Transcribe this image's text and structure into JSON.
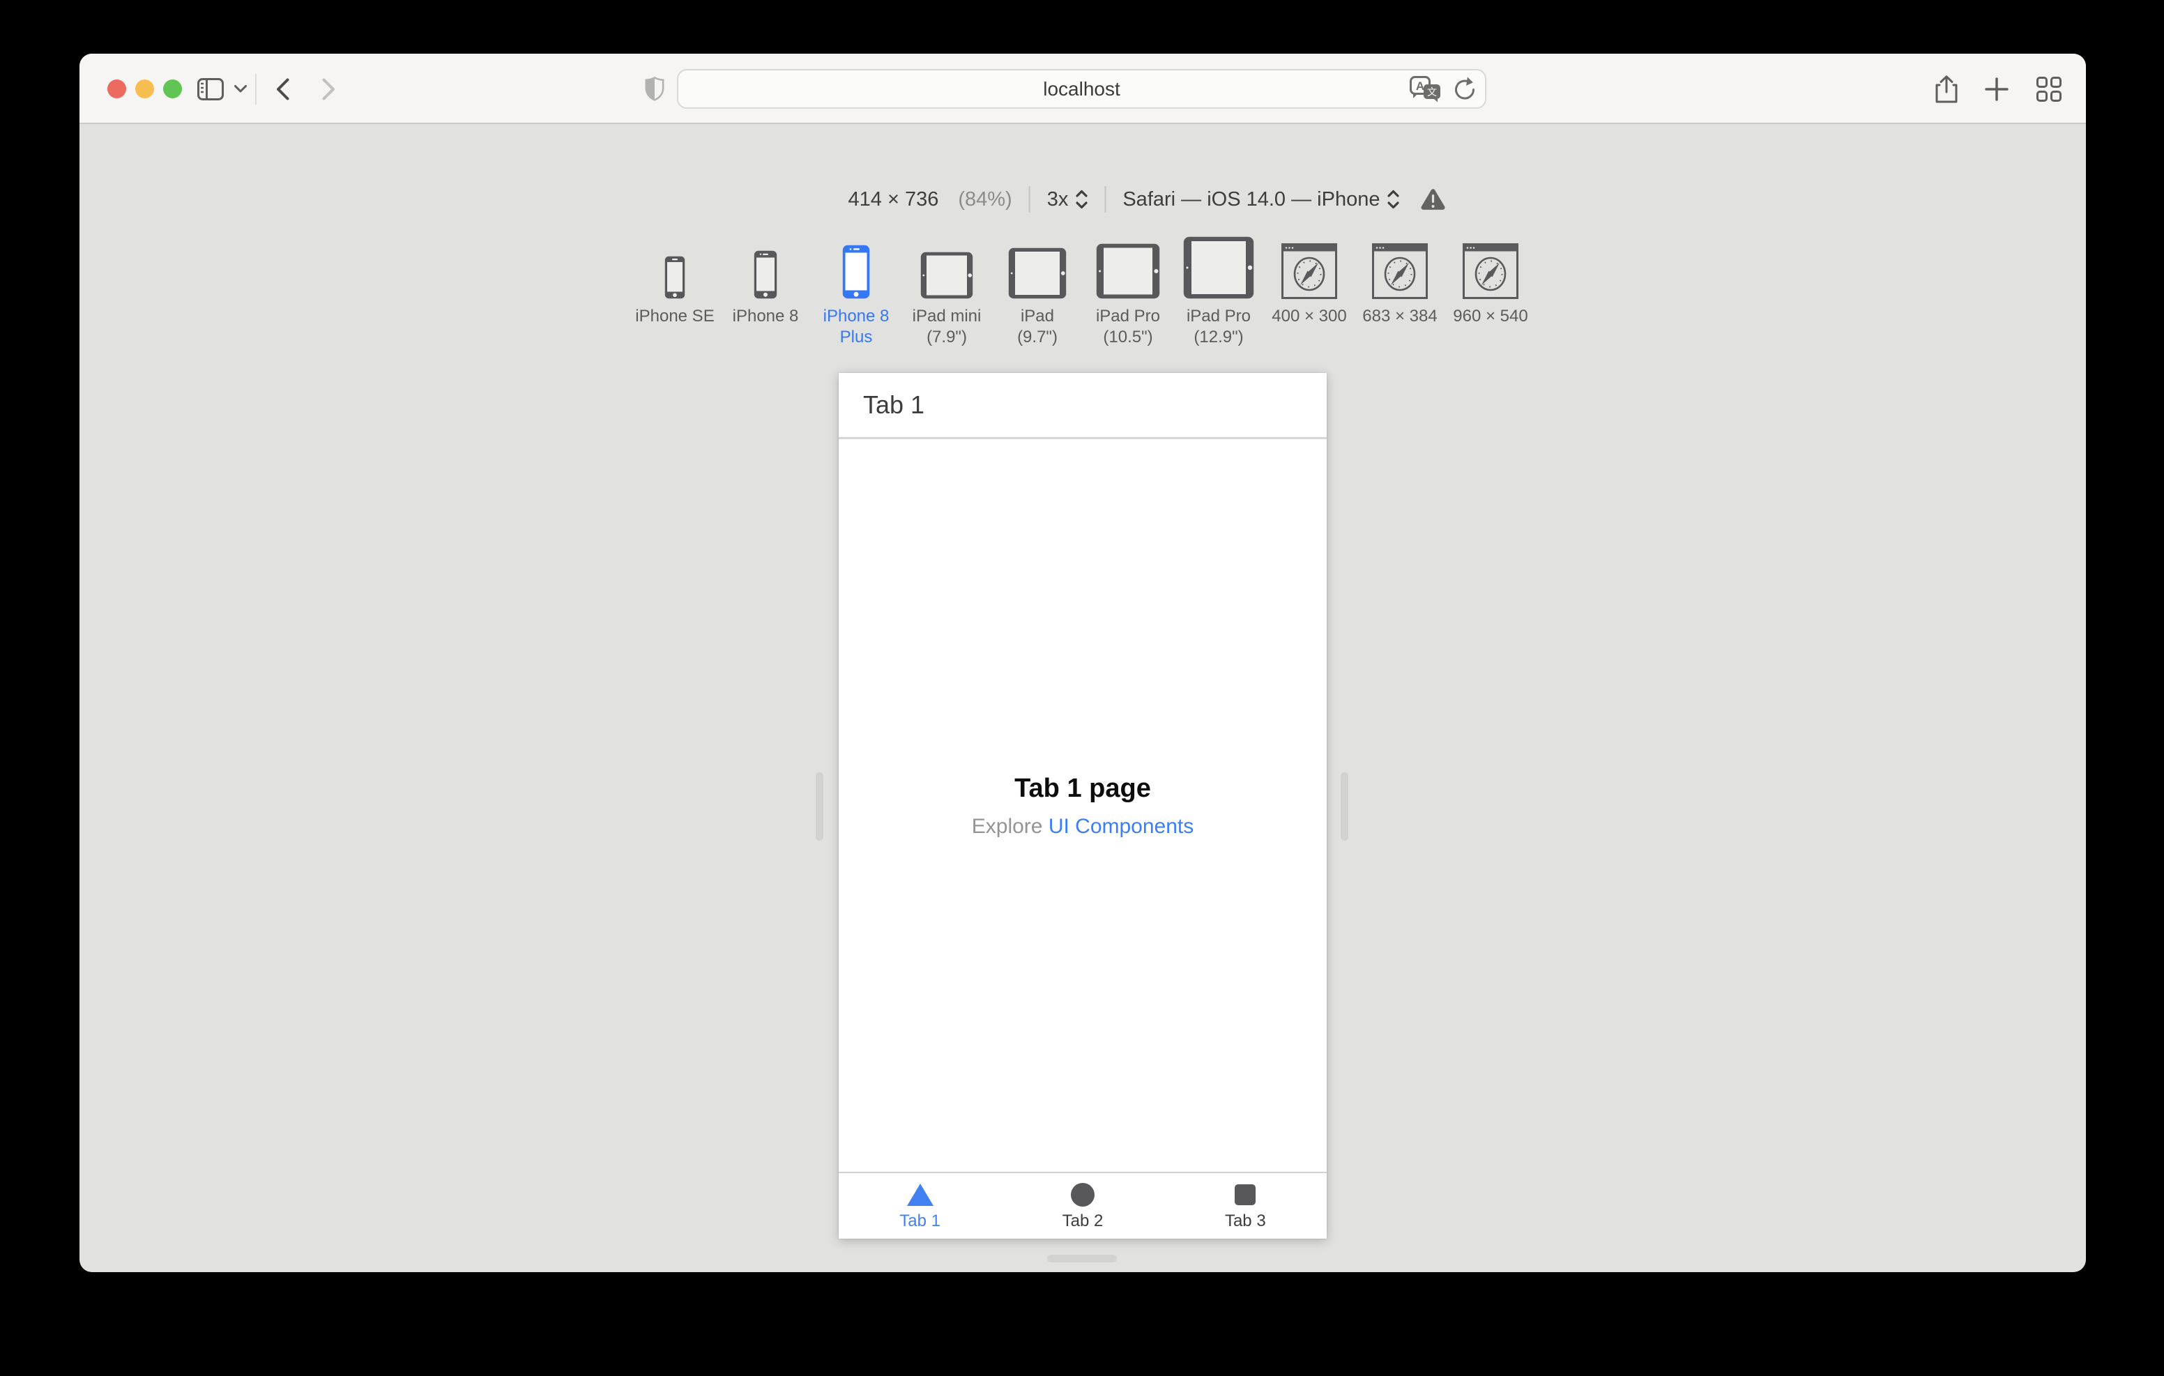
{
  "window": {
    "traffic_lights": [
      "close",
      "minimize",
      "zoom"
    ],
    "toolbar": {
      "url_value": "localhost",
      "icons": {
        "sidebar": "sidebar-panel",
        "sidebar_menu": "chevron-down",
        "back": "chevron-left",
        "forward": "chevron-right",
        "privacy": "shield-half-filled",
        "translate": "translate-bubbles",
        "reload": "circular-arrow",
        "share": "box-arrow-up",
        "new_tab": "plus",
        "tab_overview": "grid-2x2"
      }
    }
  },
  "rdm_toolbar": {
    "dimensions": "414 × 736",
    "zoom_percent": "(84%)",
    "pixel_ratio": "3x",
    "user_agent": "Safari — iOS 14.0 — iPhone",
    "warning_icon": "warning-triangle",
    "stepper_icon": "up-down-chevrons"
  },
  "devices": [
    {
      "id": "iphone-se",
      "line1": "iPhone SE",
      "line2": "",
      "type": "phone",
      "selected": false
    },
    {
      "id": "iphone-8",
      "line1": "iPhone 8",
      "line2": "",
      "type": "phone",
      "selected": false
    },
    {
      "id": "iphone-8-plus",
      "line1": "iPhone 8",
      "line2": "Plus",
      "type": "phone",
      "selected": true
    },
    {
      "id": "ipad-mini",
      "line1": "iPad mini",
      "line2": "(7.9\")",
      "type": "tablet",
      "selected": false
    },
    {
      "id": "ipad",
      "line1": "iPad",
      "line2": "(9.7\")",
      "type": "tablet",
      "selected": false
    },
    {
      "id": "ipad-pro-10-5",
      "line1": "iPad Pro",
      "line2": "(10.5\")",
      "type": "tablet",
      "selected": false
    },
    {
      "id": "ipad-pro-12-9",
      "line1": "iPad Pro",
      "line2": "(12.9\")",
      "type": "tablet",
      "selected": false
    },
    {
      "id": "preset-400x300",
      "line1": "400 × 300",
      "line2": "",
      "type": "browser",
      "selected": false
    },
    {
      "id": "preset-683x384",
      "line1": "683 × 384",
      "line2": "",
      "type": "browser",
      "selected": false
    },
    {
      "id": "preset-960x540",
      "line1": "960 × 540",
      "line2": "",
      "type": "browser",
      "selected": false
    }
  ],
  "preview": {
    "nav_title": "Tab 1",
    "page_title": "Tab 1 page",
    "subtitle_prefix": "Explore ",
    "subtitle_link": "UI Components",
    "tabs": [
      {
        "label": "Tab 1",
        "icon": "triangle",
        "active": true
      },
      {
        "label": "Tab 2",
        "icon": "circle",
        "active": false
      },
      {
        "label": "Tab 3",
        "icon": "square",
        "active": false
      }
    ]
  },
  "colors": {
    "accent_blue": "#3478F6",
    "link_blue": "#3C7EF8",
    "tab_active_blue": "#4181F1",
    "icon_gray": "#58585A",
    "titlebar_bg": "#F6F5F4",
    "content_bg": "#E1E1E0",
    "traffic_red": "#EC6A5F",
    "traffic_yellow": "#F5BF4F",
    "traffic_green": "#61C454"
  }
}
